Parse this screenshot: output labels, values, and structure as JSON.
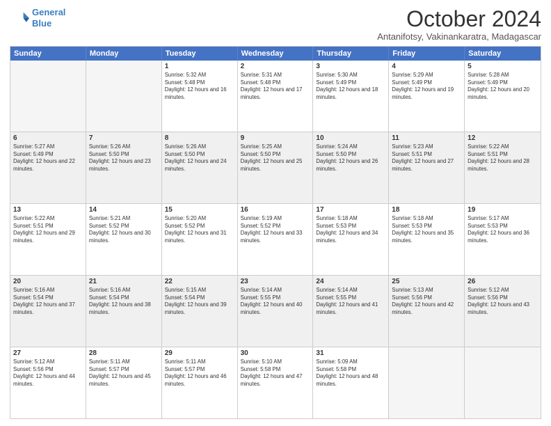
{
  "header": {
    "logo_line1": "General",
    "logo_line2": "Blue",
    "month": "October 2024",
    "location": "Antanifotsy, Vakinankaratra, Madagascar"
  },
  "weekdays": [
    "Sunday",
    "Monday",
    "Tuesday",
    "Wednesday",
    "Thursday",
    "Friday",
    "Saturday"
  ],
  "rows": [
    [
      {
        "day": "",
        "text": "",
        "empty": true
      },
      {
        "day": "",
        "text": "",
        "empty": true
      },
      {
        "day": "1",
        "text": "Sunrise: 5:32 AM\nSunset: 5:48 PM\nDaylight: 12 hours and 16 minutes."
      },
      {
        "day": "2",
        "text": "Sunrise: 5:31 AM\nSunset: 5:48 PM\nDaylight: 12 hours and 17 minutes."
      },
      {
        "day": "3",
        "text": "Sunrise: 5:30 AM\nSunset: 5:49 PM\nDaylight: 12 hours and 18 minutes."
      },
      {
        "day": "4",
        "text": "Sunrise: 5:29 AM\nSunset: 5:49 PM\nDaylight: 12 hours and 19 minutes."
      },
      {
        "day": "5",
        "text": "Sunrise: 5:28 AM\nSunset: 5:49 PM\nDaylight: 12 hours and 20 minutes."
      }
    ],
    [
      {
        "day": "6",
        "text": "Sunrise: 5:27 AM\nSunset: 5:49 PM\nDaylight: 12 hours and 22 minutes.",
        "shaded": true
      },
      {
        "day": "7",
        "text": "Sunrise: 5:26 AM\nSunset: 5:50 PM\nDaylight: 12 hours and 23 minutes.",
        "shaded": true
      },
      {
        "day": "8",
        "text": "Sunrise: 5:26 AM\nSunset: 5:50 PM\nDaylight: 12 hours and 24 minutes.",
        "shaded": true
      },
      {
        "day": "9",
        "text": "Sunrise: 5:25 AM\nSunset: 5:50 PM\nDaylight: 12 hours and 25 minutes.",
        "shaded": true
      },
      {
        "day": "10",
        "text": "Sunrise: 5:24 AM\nSunset: 5:50 PM\nDaylight: 12 hours and 26 minutes.",
        "shaded": true
      },
      {
        "day": "11",
        "text": "Sunrise: 5:23 AM\nSunset: 5:51 PM\nDaylight: 12 hours and 27 minutes.",
        "shaded": true
      },
      {
        "day": "12",
        "text": "Sunrise: 5:22 AM\nSunset: 5:51 PM\nDaylight: 12 hours and 28 minutes.",
        "shaded": true
      }
    ],
    [
      {
        "day": "13",
        "text": "Sunrise: 5:22 AM\nSunset: 5:51 PM\nDaylight: 12 hours and 29 minutes."
      },
      {
        "day": "14",
        "text": "Sunrise: 5:21 AM\nSunset: 5:52 PM\nDaylight: 12 hours and 30 minutes."
      },
      {
        "day": "15",
        "text": "Sunrise: 5:20 AM\nSunset: 5:52 PM\nDaylight: 12 hours and 31 minutes."
      },
      {
        "day": "16",
        "text": "Sunrise: 5:19 AM\nSunset: 5:52 PM\nDaylight: 12 hours and 33 minutes."
      },
      {
        "day": "17",
        "text": "Sunrise: 5:18 AM\nSunset: 5:53 PM\nDaylight: 12 hours and 34 minutes."
      },
      {
        "day": "18",
        "text": "Sunrise: 5:18 AM\nSunset: 5:53 PM\nDaylight: 12 hours and 35 minutes."
      },
      {
        "day": "19",
        "text": "Sunrise: 5:17 AM\nSunset: 5:53 PM\nDaylight: 12 hours and 36 minutes."
      }
    ],
    [
      {
        "day": "20",
        "text": "Sunrise: 5:16 AM\nSunset: 5:54 PM\nDaylight: 12 hours and 37 minutes.",
        "shaded": true
      },
      {
        "day": "21",
        "text": "Sunrise: 5:16 AM\nSunset: 5:54 PM\nDaylight: 12 hours and 38 minutes.",
        "shaded": true
      },
      {
        "day": "22",
        "text": "Sunrise: 5:15 AM\nSunset: 5:54 PM\nDaylight: 12 hours and 39 minutes.",
        "shaded": true
      },
      {
        "day": "23",
        "text": "Sunrise: 5:14 AM\nSunset: 5:55 PM\nDaylight: 12 hours and 40 minutes.",
        "shaded": true
      },
      {
        "day": "24",
        "text": "Sunrise: 5:14 AM\nSunset: 5:55 PM\nDaylight: 12 hours and 41 minutes.",
        "shaded": true
      },
      {
        "day": "25",
        "text": "Sunrise: 5:13 AM\nSunset: 5:56 PM\nDaylight: 12 hours and 42 minutes.",
        "shaded": true
      },
      {
        "day": "26",
        "text": "Sunrise: 5:12 AM\nSunset: 5:56 PM\nDaylight: 12 hours and 43 minutes.",
        "shaded": true
      }
    ],
    [
      {
        "day": "27",
        "text": "Sunrise: 5:12 AM\nSunset: 5:56 PM\nDaylight: 12 hours and 44 minutes."
      },
      {
        "day": "28",
        "text": "Sunrise: 5:11 AM\nSunset: 5:57 PM\nDaylight: 12 hours and 45 minutes."
      },
      {
        "day": "29",
        "text": "Sunrise: 5:11 AM\nSunset: 5:57 PM\nDaylight: 12 hours and 46 minutes."
      },
      {
        "day": "30",
        "text": "Sunrise: 5:10 AM\nSunset: 5:58 PM\nDaylight: 12 hours and 47 minutes."
      },
      {
        "day": "31",
        "text": "Sunrise: 5:09 AM\nSunset: 5:58 PM\nDaylight: 12 hours and 48 minutes."
      },
      {
        "day": "",
        "text": "",
        "empty": true
      },
      {
        "day": "",
        "text": "",
        "empty": true
      }
    ]
  ]
}
